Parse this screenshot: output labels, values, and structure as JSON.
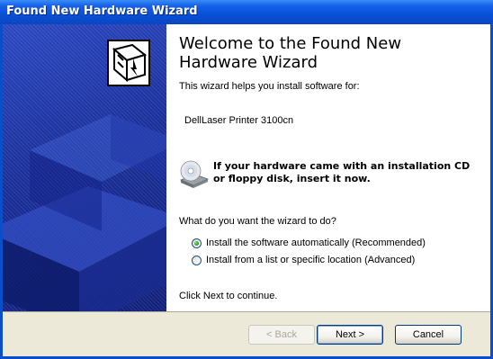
{
  "window": {
    "title": "Found New Hardware Wizard"
  },
  "heading": "Welcome to the Found New Hardware Wizard",
  "intro": "This wizard helps you install software for:",
  "device_name": "DellLaser Printer 3100cn",
  "cd_prompt": "If your hardware came with an installation CD or floppy disk, insert it now.",
  "question": "What do you want the wizard to do?",
  "options": [
    {
      "label": "Install the software automatically (Recommended)",
      "selected": true
    },
    {
      "label": "Install from a list or specific location (Advanced)",
      "selected": false
    }
  ],
  "continue_text": "Click Next to continue.",
  "buttons": {
    "back": "< Back",
    "next": "Next >",
    "cancel": "Cancel"
  },
  "icons": {
    "sidebar_art": "hardware-install-icon",
    "cd": "cd-drive-icon"
  },
  "colors": {
    "title_bar": "#0a4fc8",
    "sidebar": "#1a2f9a",
    "footer": "#ece9d8",
    "radio_selected": "#21a121"
  }
}
